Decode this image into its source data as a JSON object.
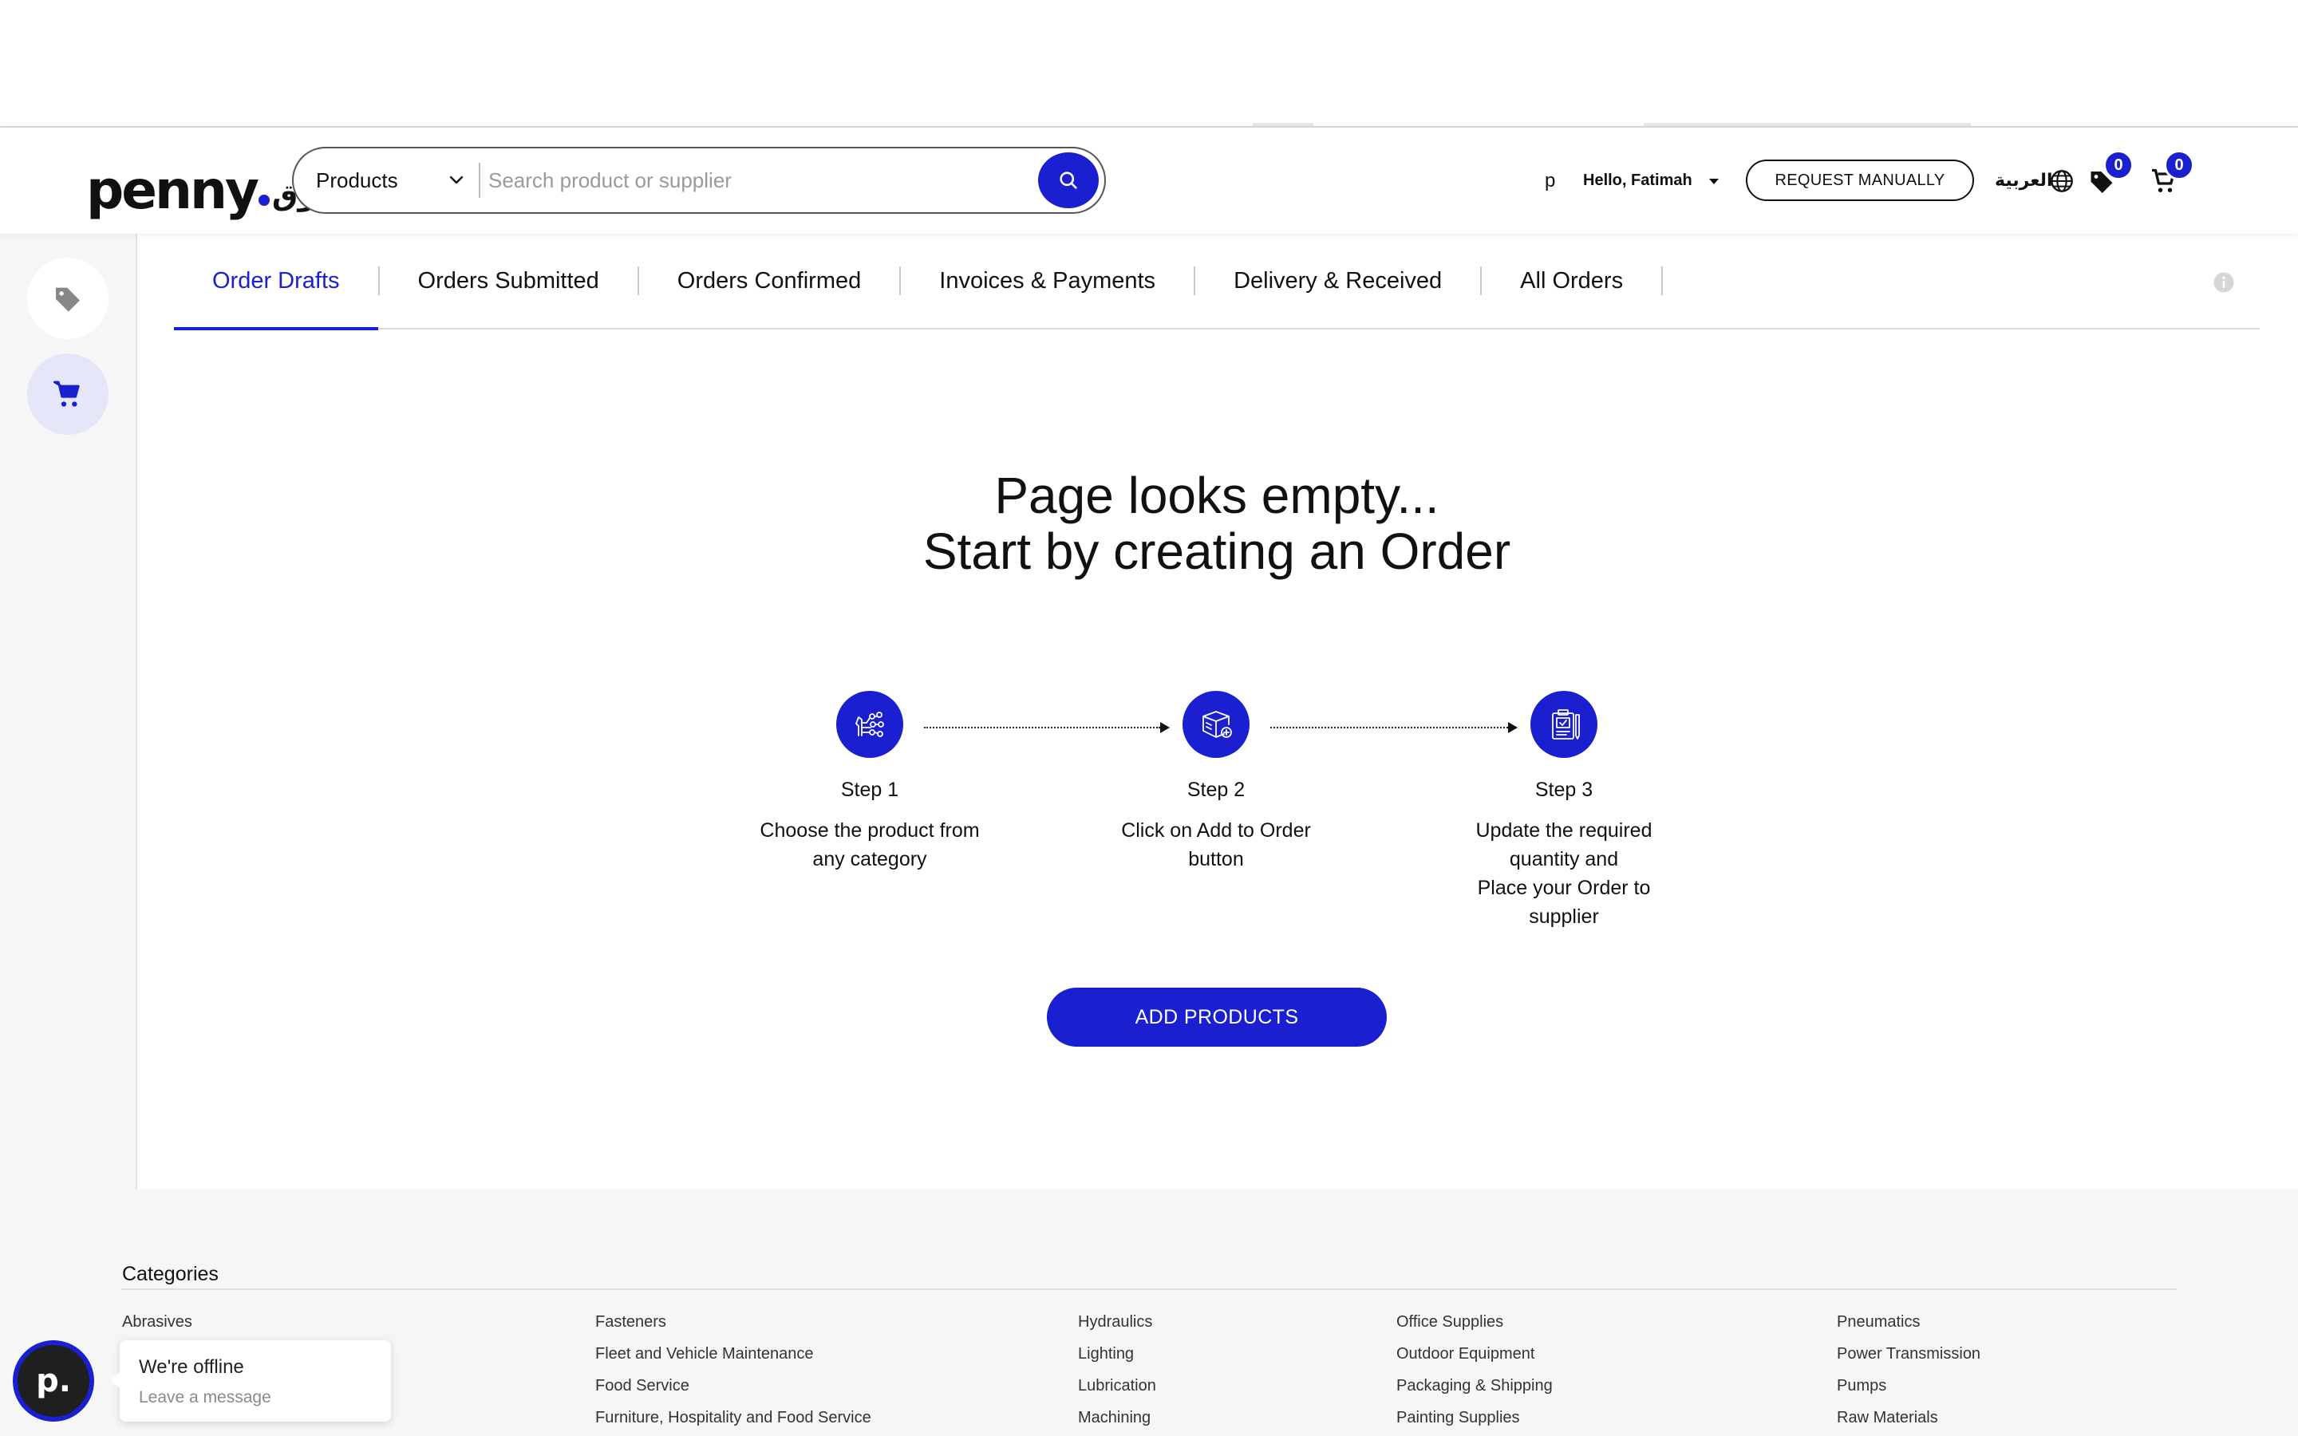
{
  "header": {
    "logo_en": "penny",
    "logo_ar": "سوق",
    "search_category": "Products",
    "search_placeholder": "Search product or supplier",
    "user_initial": "p",
    "greeting": "Hello, Fatimah",
    "request_button": "REQUEST MANUALLY",
    "language": "العربية",
    "wishlist_count": "0",
    "cart_count": "0"
  },
  "tabs": [
    {
      "label": "Order Drafts",
      "active": true
    },
    {
      "label": "Orders Submitted"
    },
    {
      "label": "Orders Confirmed"
    },
    {
      "label": "Invoices & Payments"
    },
    {
      "label": "Delivery & Received"
    },
    {
      "label": "All Orders"
    }
  ],
  "empty": {
    "line1": "Page looks empty...",
    "line2": "Start by creating an Order"
  },
  "steps": [
    {
      "label": "Step 1",
      "desc": [
        "Choose the product from",
        "any category"
      ]
    },
    {
      "label": "Step 2",
      "desc": [
        "Click on Add to Order",
        "button"
      ]
    },
    {
      "label": "Step 3",
      "desc": [
        "Update the required",
        "quantity and",
        "Place your Order to",
        "supplier"
      ]
    }
  ],
  "add_button": "ADD PRODUCTS",
  "footer": {
    "title": "Categories",
    "columns": [
      [
        "Abrasives"
      ],
      [
        "Fasteners",
        "Fleet and Vehicle Maintenance",
        "Food Service",
        "Furniture, Hospitality and Food Service"
      ],
      [
        "Hydraulics",
        "Lighting",
        "Lubrication",
        "Machining"
      ],
      [
        "Office Supplies",
        "Outdoor Equipment",
        "Packaging & Shipping",
        "Painting Supplies"
      ],
      [
        "Pneumatics",
        "Power Transmission",
        "Pumps",
        "Raw Materials"
      ]
    ]
  },
  "chat": {
    "avatar": "p.",
    "status": "We're offline",
    "sub": "Leave a message"
  },
  "colors": {
    "accent": "#1a1fcf",
    "sidebar_bg": "#f6f6f6",
    "footer_bg": "#f6f6f6"
  }
}
